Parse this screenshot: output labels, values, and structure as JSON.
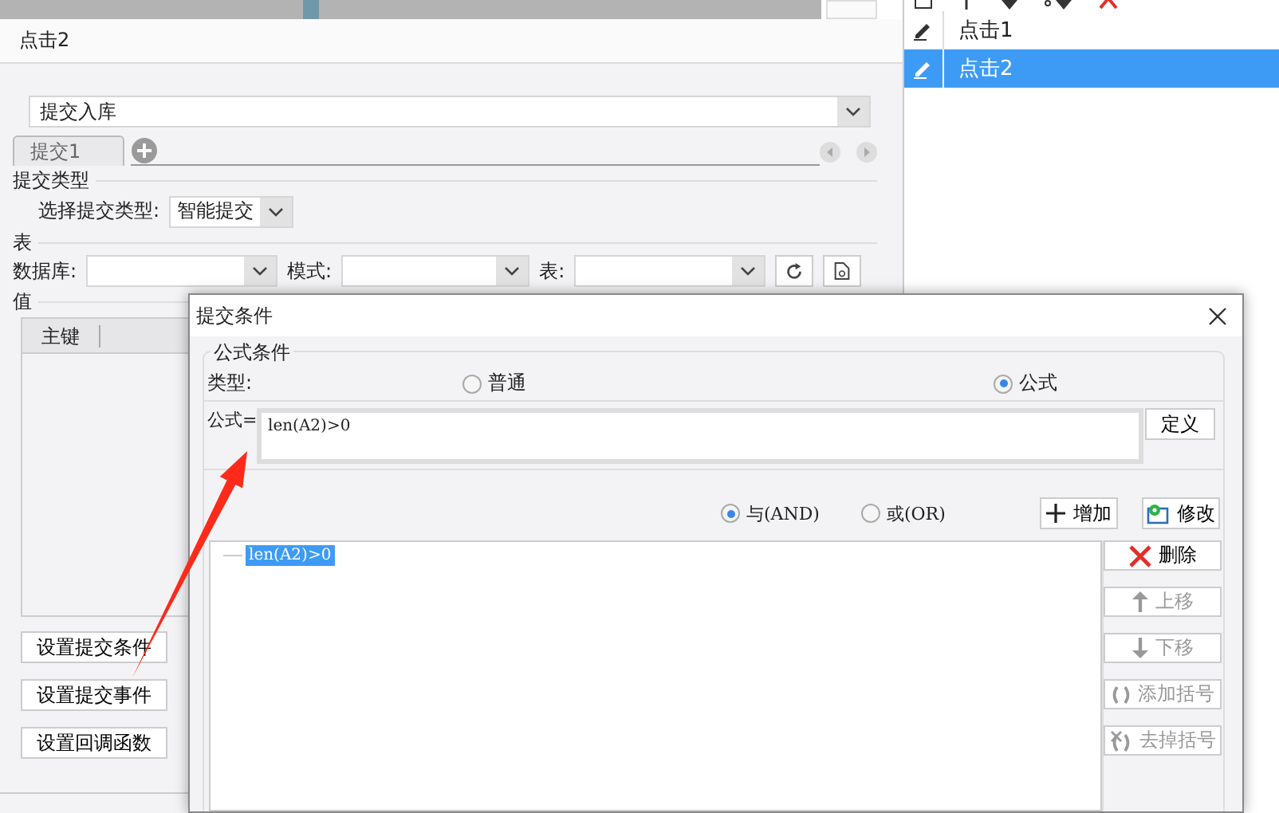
{
  "event_list": {
    "items": [
      {
        "label": "点击1",
        "selected": false
      },
      {
        "label": "点击2",
        "selected": true
      }
    ]
  },
  "editor": {
    "title": "点击2",
    "action": {
      "value": "提交入库"
    },
    "tabs": [
      {
        "label": "提交1"
      }
    ],
    "submit_type": {
      "heading": "提交类型",
      "label": "选择提交类型:",
      "value": "智能提交"
    },
    "table_section": {
      "heading": "表",
      "fields": [
        {
          "label": "数据库:"
        },
        {
          "label": "模式:"
        },
        {
          "label": "表:"
        }
      ]
    },
    "values": {
      "heading": "值",
      "columns": [
        "主键"
      ]
    },
    "buttons": [
      "设置提交条件",
      "设置提交事件",
      "设置回调函数"
    ]
  },
  "dialog": {
    "title": "提交条件",
    "group": "公式条件",
    "type_label": "类型:",
    "type_options": [
      {
        "label": "普通",
        "selected": false
      },
      {
        "label": "公式",
        "selected": true
      }
    ],
    "formula_label": "公式=",
    "formula": "len(A2)>0",
    "define_button": "定义",
    "logic_options": [
      {
        "label": "与(AND)",
        "selected": true
      },
      {
        "label": "或(OR)",
        "selected": false
      }
    ],
    "add_button": "增加",
    "edit_button": "修改",
    "conditions": [
      {
        "text": "len(A2)>0",
        "selected": true
      }
    ],
    "side_buttons": [
      {
        "label": "删除",
        "kind": "delete",
        "disabled": false
      },
      {
        "label": "上移",
        "kind": "up",
        "disabled": true
      },
      {
        "label": "下移",
        "kind": "down",
        "disabled": true
      },
      {
        "label": "添加括号",
        "kind": "add_brackets",
        "disabled": true
      },
      {
        "label": "去掉括号",
        "kind": "remove_brackets",
        "disabled": true
      }
    ]
  }
}
